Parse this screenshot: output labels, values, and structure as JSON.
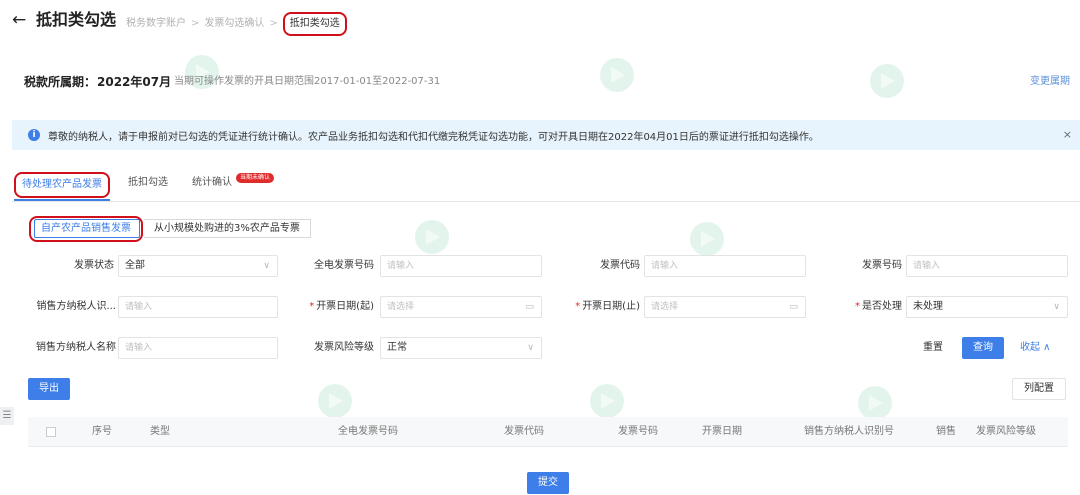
{
  "header": {
    "back_icon": "arrow-left-icon",
    "title": "抵扣类勾选",
    "breadcrumb": [
      "税务数字账户",
      "发票勾选确认",
      "抵扣类勾选"
    ],
    "breadcrumb_separator": ">"
  },
  "period": {
    "label": "税款所属期：",
    "value": "2022年07月",
    "range_text": "当期可操作发票的开具日期范围2017-01-01至2022-07-31",
    "change_label": "变更属期"
  },
  "notice": {
    "icon": "info-icon",
    "text": "尊敬的纳税人，请于申报前对已勾选的凭证进行统计确认。农产品业务抵扣勾选和代扣代缴完税凭证勾选功能，可对开具日期在2022年04月01日后的票证进行抵扣勾选操作。",
    "close": "×"
  },
  "tabs": {
    "items": [
      "待处理农产品发票",
      "抵扣勾选",
      "统计确认"
    ],
    "badge": "当期未确认"
  },
  "subtabs": [
    "自产农产品销售发票",
    "从小规模处购进的3%农产品专票"
  ],
  "form": {
    "invoice_status": {
      "label": "发票状态",
      "value": "全部"
    },
    "full_invoice_no": {
      "label": "全电发票号码",
      "placeholder": "请输入"
    },
    "invoice_code": {
      "label": "发票代码",
      "placeholder": "请输入"
    },
    "invoice_no": {
      "label": "发票号码",
      "placeholder": "请输入"
    },
    "seller_tax_id": {
      "label": "销售方纳税人识...",
      "placeholder": "请输入"
    },
    "issue_date_start": {
      "label": "开票日期(起)",
      "placeholder": "请选择"
    },
    "issue_date_end": {
      "label": "开票日期(止)",
      "placeholder": "请选择"
    },
    "processed": {
      "label": "是否处理",
      "value": "未处理"
    },
    "seller_name": {
      "label": "销售方纳税人名称",
      "placeholder": "请输入"
    },
    "risk_level": {
      "label": "发票风险等级",
      "value": "正常"
    },
    "required_mark": "*"
  },
  "actions": {
    "reset": "重置",
    "query": "查询",
    "collapse": "收起 ∧",
    "export": "导出",
    "columns": "列配置",
    "submit": "提交"
  },
  "table": {
    "columns": [
      "序号",
      "类型",
      "全电发票号码",
      "发票代码",
      "发票号码",
      "开票日期",
      "销售方纳税人识别号",
      "销售",
      "发票风险等级"
    ]
  },
  "colors": {
    "primary": "#3d7ee8",
    "highlight_ring": "#d0101a",
    "notice_bg": "#e8f4fd",
    "badge": "#e02b2b"
  }
}
